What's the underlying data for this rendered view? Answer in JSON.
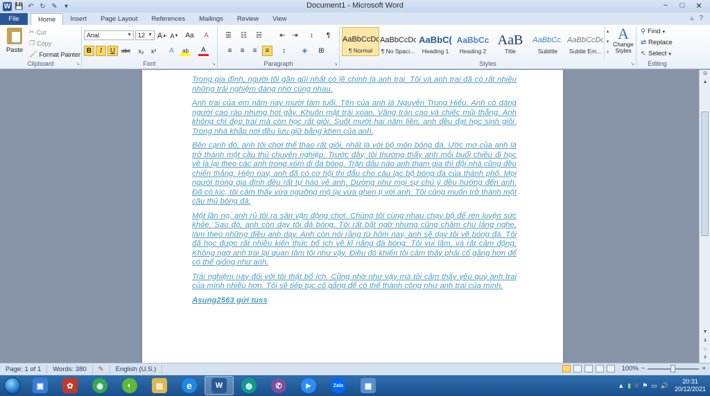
{
  "window": {
    "title": "Document1 - Microsoft Word",
    "controls": {
      "minimize": "−",
      "maximize": "□",
      "close": "✕"
    }
  },
  "quick_access": {
    "app_icon": "W",
    "items": [
      {
        "name": "save-icon",
        "glyph": "💾"
      },
      {
        "name": "undo-icon",
        "glyph": "↶"
      },
      {
        "name": "redo-icon",
        "glyph": "↻"
      },
      {
        "name": "new-document-icon",
        "glyph": "✎"
      },
      {
        "name": "customize-qat-icon",
        "glyph": "▾"
      }
    ]
  },
  "ribbon_tabs": [
    "File",
    "Home",
    "Insert",
    "Page Layout",
    "References",
    "Mailings",
    "Review",
    "View"
  ],
  "ribbon_right": {
    "minimize": "▵",
    "help": "?"
  },
  "clipboard": {
    "label": "Clipboard",
    "paste": "Paste",
    "cut": "Cut",
    "copy": "Copy",
    "format_painter": "Format Painter"
  },
  "font": {
    "label": "Font",
    "name": "Arial",
    "size": "12",
    "grow": "A",
    "shrink": "A",
    "change_case": "Aa",
    "clear": "A",
    "bold": "B",
    "italic": "I",
    "underline": "U",
    "strike": "abc",
    "subscript": "x₂",
    "superscript": "x²",
    "text_effects": "A",
    "highlight": "ab",
    "font_color": "A"
  },
  "paragraph": {
    "label": "Paragraph",
    "bullets": "☰",
    "numbering": "☷",
    "multilevel": "☵",
    "decrease_indent": "⇤",
    "increase_indent": "⇥",
    "sort": "↕",
    "show_marks": "¶",
    "align_left": "≡",
    "align_center": "≡",
    "align_right": "≡",
    "justify": "≡",
    "line_spacing": "↕",
    "shading": "◈",
    "borders": "⊞"
  },
  "styles": {
    "label": "Styles",
    "items": [
      {
        "sample": "AaBbCcDc",
        "name": "¶ Normal"
      },
      {
        "sample": "AaBbCcDc",
        "name": "¶ No Spaci..."
      },
      {
        "sample": "AaBbC(",
        "name": "Heading 1"
      },
      {
        "sample": "AaBbCc",
        "name": "Heading 2"
      },
      {
        "sample": "AaB",
        "name": "Title"
      },
      {
        "sample": "AaBbCc.",
        "name": "Subtitle"
      },
      {
        "sample": "AaBbCcDc",
        "name": "Subtle Em..."
      }
    ],
    "change_styles": "Change Styles",
    "change_styles_glyph": "A"
  },
  "editing": {
    "label": "Editing",
    "find": "Find",
    "replace": "Replace",
    "select": "Select"
  },
  "document": {
    "paragraphs": [
      "Trong gia đình, người tôi gần gũi nhất có lẽ chính là anh trai. Tôi và anh trai đã có rất nhiều những trải nghiệm đáng nhớ cùng nhau.",
      "Anh trai của em năm nay mười tám tuổi. Tên của anh là Nguyễn Trung Hiếu. Anh có dáng người cao ráo nhưng hơi gầy. Khuôn mặt trái xoan. Vầng trán cao và chiếc mũi thẳng. Anh không chỉ đẹp trai mà còn học rất giỏi. Suốt mười hai năm liền, anh đều đạt học sinh giỏi. Trong nhà khắp nơi đều lưu giữ bằng khen của anh.",
      "Bên cạnh đó, anh tôi chơi thể thao rất giỏi, nhất là với bộ môn bóng đá. Ước mơ của anh là trở thành một cầu thủ chuyên nghiệp. Trước đây, tôi thường thấy anh mỗi buổi chiều đi học về là lại theo các anh trong xóm đi đá bóng. Trận đấu nào anh tham gia thì đội nhà cũng đều chiến thắng. Hiện nay, anh đã có cơ hội thi đấu cho câu lạc bộ bóng đá của thành phố. Mọi người trong gia đình đều rất tự hào về anh. Dường như mọi sự chú ý đều hướng đến anh. Đã có lúc, tôi cảm thấy vừa ngưỡng mộ lại vừa ghen tị với anh. Tôi cũng muốn trở thành một cầu thủ bóng đá.",
      "Một lần nọ, anh rủ tôi ra sân vận động chơi. Chúng tôi cùng nhau chạy bộ để rèn luyện sức khỏe. Sau đó, anh còn dạy tôi đá bóng. Tôi rất bất ngờ nhưng cũng chăm chú lắng nghe, làm theo những điều anh dạy. Anh còn nói rằng từ hôm nay, anh sẽ dạy tôi về bóng đá. Tôi đã học được rất nhiều kiến thức bổ ích về kĩ năng đá bóng. Tôi vui lắm, và rất cảm động. Không ngờ anh trai lại quan tâm tôi như vậy. Điều đó khiến tôi cảm thấy phải cố gắng hơn để có thể giống như anh.",
      "Trải nghiệm này đối với tôi thật bổ ích. Cũng nhờ như vậy mà tôi cảm thấy yêu quý anh trai của mình nhiều hơn. Tôi sẽ tiếp tục cố gắng để có thể thành công như anh trai của mình."
    ],
    "signature": "Asung2563 gửi tuss",
    "text_color": "#4e9ec2"
  },
  "statusbar": {
    "page": "Page: 1 of 1",
    "words": "Words: 380",
    "language": "English (U.S.)",
    "zoom": "100%",
    "zoom_out": "−",
    "zoom_in": "+"
  },
  "taskbar": {
    "apps": [
      {
        "name": "taskbar-app-explorer-pinned",
        "glyph": "▣",
        "color": "#3a7bd5"
      },
      {
        "name": "taskbar-app-paint",
        "glyph": "✿",
        "color": "#c0392b"
      },
      {
        "name": "taskbar-app-chrome",
        "glyph": "◉",
        "color": "#34a853"
      },
      {
        "name": "taskbar-app-coccoc",
        "glyph": "◐",
        "color": "#5fb836"
      },
      {
        "name": "taskbar-app-file-explorer",
        "glyph": "▤",
        "color": "#e0b74a"
      },
      {
        "name": "taskbar-app-internet-explorer",
        "glyph": "e",
        "color": "#1e88e5"
      },
      {
        "name": "taskbar-app-word",
        "glyph": "W",
        "color": "#2b5797"
      },
      {
        "name": "taskbar-app-edge",
        "glyph": "◍",
        "color": "#0f9d8a"
      },
      {
        "name": "taskbar-app-viber",
        "glyph": "✆",
        "color": "#7b519d"
      },
      {
        "name": "taskbar-app-zoom",
        "glyph": "▶",
        "color": "#2d8cff"
      },
      {
        "name": "taskbar-app-zalo",
        "glyph": "Zalo",
        "color": "#0068ff"
      },
      {
        "name": "taskbar-app-photos",
        "glyph": "▦",
        "color": "#5b8fc9"
      }
    ],
    "clock_time": "20:31",
    "clock_date": "20/12/2021"
  }
}
